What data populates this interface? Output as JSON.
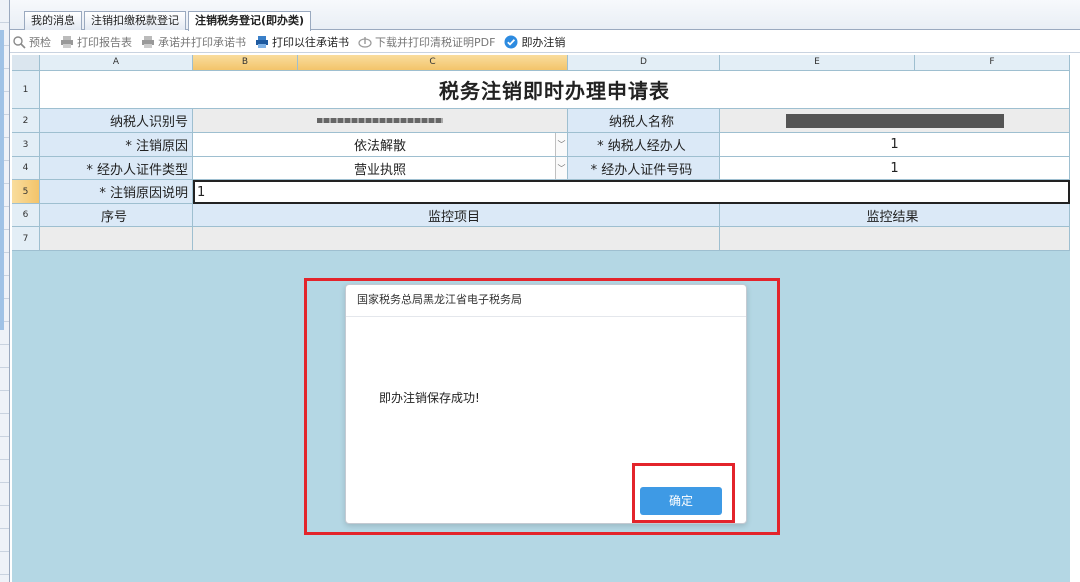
{
  "tabs": [
    "我的消息",
    "注销扣缴税款登记",
    "注销税务登记(即办类)"
  ],
  "toolbar": {
    "preview": "预检",
    "print_report": "打印报告表",
    "promise_print": "承诺并打印承诺书",
    "print_prev_promise": "打印以往承诺书",
    "download_pdf": "下载并打印清税证明PDF",
    "instant_cancel": "即办注销"
  },
  "sheet": {
    "columns": [
      "A",
      "B",
      "C",
      "D",
      "E",
      "F"
    ],
    "rows": [
      "1",
      "2",
      "3",
      "4",
      "5",
      "6",
      "7"
    ],
    "title": "税务注销即时办理申请表",
    "taxpayer_id_label": "纳税人识别号",
    "taxpayer_name_label": "纳税人名称",
    "cancel_reason_label": "* 注销原因",
    "cancel_reason_value": "依法解散",
    "agent_label": "* 纳税人经办人",
    "agent_value": "1",
    "id_type_label": "* 经办人证件类型",
    "id_type_value": "营业执照",
    "id_number_label": "* 经办人证件号码",
    "id_number_value": "1",
    "reason_desc_label": "* 注销原因说明",
    "reason_desc_value": "1",
    "seq_header": "序号",
    "monitor_item_header": "监控项目",
    "monitor_result_header": "监控结果"
  },
  "dialog": {
    "title": "国家税务总局黑龙江省电子税务局",
    "message": "即办注销保存成功!",
    "ok_label": "确定"
  },
  "colors": {
    "highlight": "#e3242b",
    "button": "#3e9ae5",
    "sheet_bg": "#b4d7e4"
  }
}
